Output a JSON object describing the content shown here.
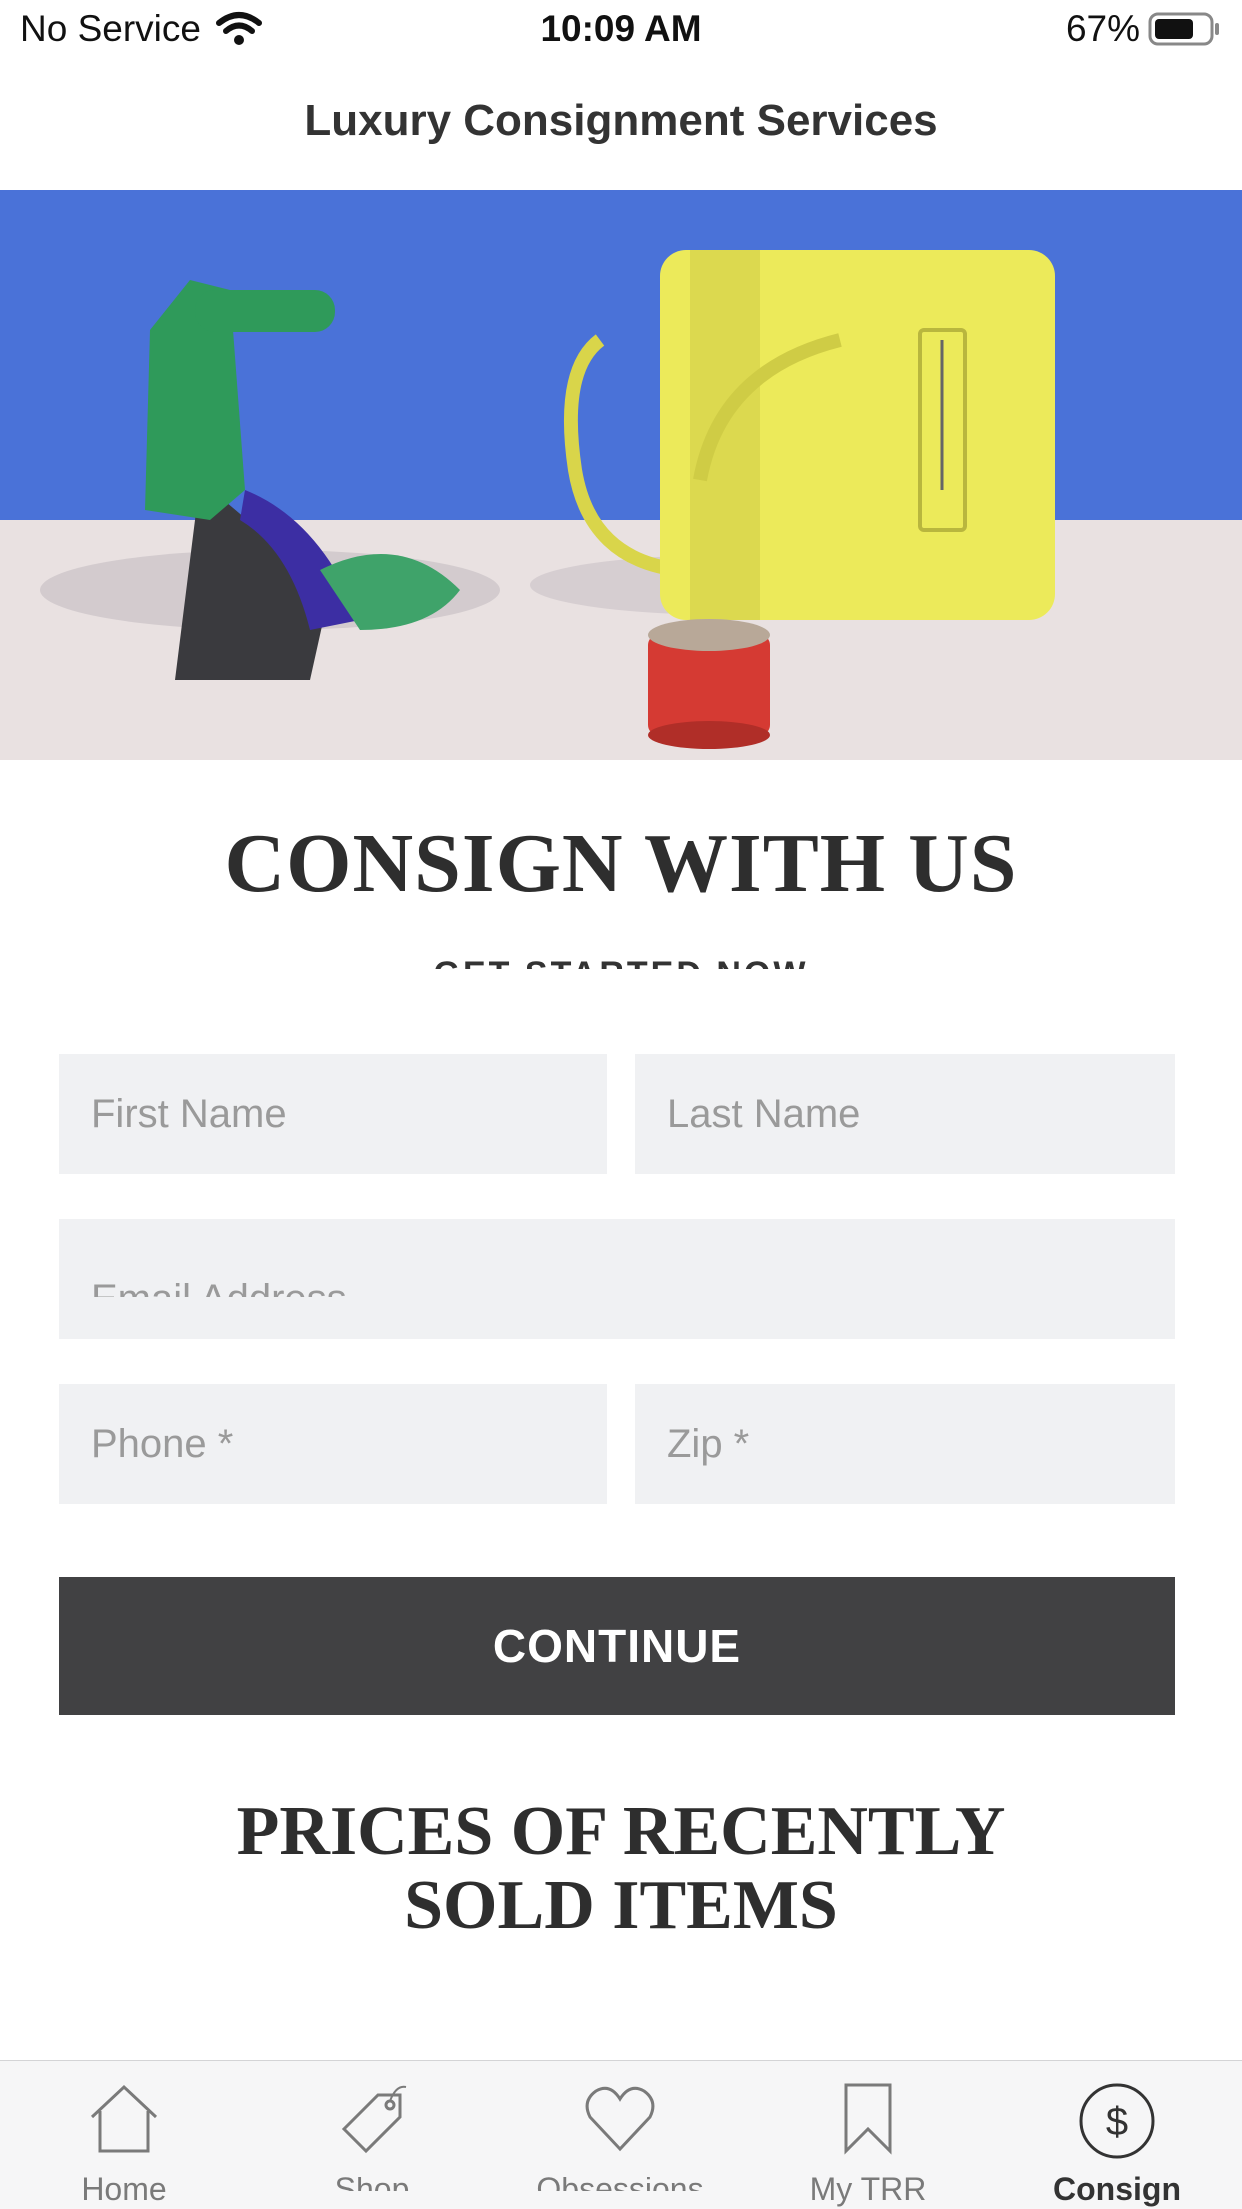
{
  "status_bar": {
    "carrier": "No Service",
    "time": "10:09 AM",
    "battery": "67%"
  },
  "header": {
    "title": "Luxury Consignment Services"
  },
  "hero": {
    "description_icons": [
      "sandal",
      "handbag",
      "bracelet"
    ]
  },
  "main": {
    "heading": "CONSIGN WITH US",
    "subheading": "GET STARTED NOW",
    "form": {
      "first_name_placeholder": "First Name",
      "last_name_placeholder": "Last Name",
      "email_placeholder": "Email Address",
      "phone_placeholder": "Phone *",
      "zip_placeholder": "Zip *",
      "continue_label": "CONTINUE"
    },
    "prices_heading_line1": "PRICES OF RECENTLY",
    "prices_heading_line2": "SOLD ITEMS"
  },
  "tab_bar": {
    "tabs": [
      {
        "label": "Home",
        "icon": "home-icon"
      },
      {
        "label": "Shop",
        "icon": "tag-icon"
      },
      {
        "label": "Obsessions",
        "icon": "heart-icon"
      },
      {
        "label": "My TRR",
        "icon": "bookmark-icon"
      },
      {
        "label": "Consign",
        "icon": "dollar-icon"
      }
    ],
    "active": "Consign"
  },
  "colors": {
    "hero_wall": "#4a72d8",
    "hero_floor": "#e9e1e1",
    "field_bg": "#f0f1f3",
    "button_bg": "#414143",
    "tab_bar_bg": "#f6f6f7"
  }
}
